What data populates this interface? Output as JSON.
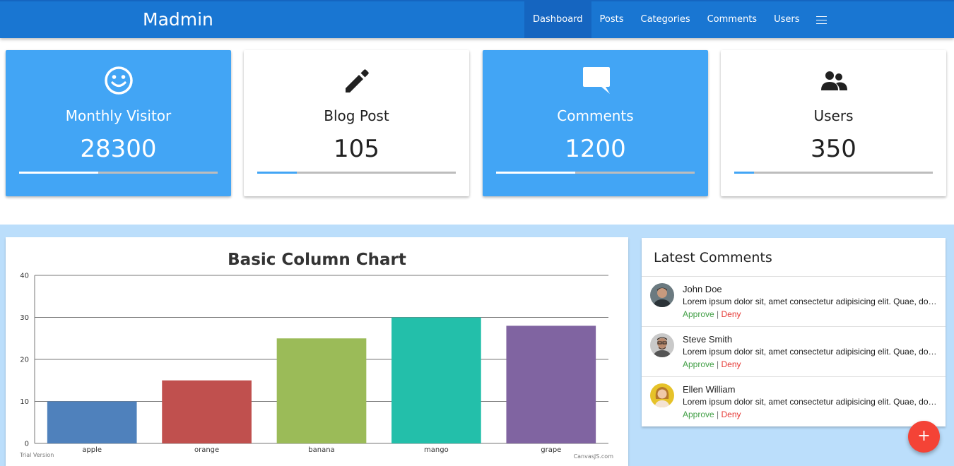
{
  "app": {
    "brand": "Madmin"
  },
  "nav": {
    "items": [
      {
        "label": "Dashboard",
        "active": true
      },
      {
        "label": "Posts"
      },
      {
        "label": "Categories"
      },
      {
        "label": "Comments"
      },
      {
        "label": "Users"
      }
    ],
    "menu_icon": "hamburger-icon"
  },
  "stats": [
    {
      "icon": "smiley-face-icon",
      "label": "Monthly Visitor",
      "value": "28300",
      "progress": 0.4,
      "style": "blue"
    },
    {
      "icon": "pencil-icon",
      "label": "Blog Post",
      "value": "105",
      "progress": 0.2,
      "style": "white"
    },
    {
      "icon": "comment-bubble-icon",
      "label": "Comments",
      "value": "1200",
      "progress": 0.4,
      "style": "blue"
    },
    {
      "icon": "users-group-icon",
      "label": "Users",
      "value": "350",
      "progress": 0.1,
      "style": "white"
    }
  ],
  "colors": {
    "navbar": "#1976d2",
    "card_blue": "#42a5f5",
    "lower_bg": "#bbdefb",
    "approve": "#43a047",
    "deny": "#e53935",
    "fab": "#f44336"
  },
  "chart_data": {
    "type": "bar",
    "title": "Basic Column Chart",
    "categories": [
      "apple",
      "orange",
      "banana",
      "mango",
      "grape"
    ],
    "values": [
      10,
      15,
      25,
      30,
      28
    ],
    "colors": [
      "#4f81bc",
      "#c0504e",
      "#9bbb58",
      "#23bfaa",
      "#8064a1"
    ],
    "ylim": [
      0,
      40
    ],
    "yticks": [
      0,
      10,
      20,
      30,
      40
    ],
    "grid": true,
    "watermark_left": "Trial Version",
    "watermark_right": "CanvasJS.com"
  },
  "comments": {
    "title": "Latest Comments",
    "items": [
      {
        "name": "John Doe",
        "text": "Lorem ipsum dolor sit, amet consectetur adipisicing elit. Quae, dolorum.",
        "approve": "Approve",
        "separator": "|",
        "deny": "Deny"
      },
      {
        "name": "Steve Smith",
        "text": "Lorem ipsum dolor sit, amet consectetur adipisicing elit. Quae, dolorum.",
        "approve": "Approve",
        "separator": "|",
        "deny": "Deny"
      },
      {
        "name": "Ellen William",
        "text": "Lorem ipsum dolor sit, amet consectetur adipisicing elit. Quae, dolorum.",
        "approve": "Approve",
        "separator": "|",
        "deny": "Deny"
      }
    ]
  },
  "fab": {
    "label": "+"
  }
}
